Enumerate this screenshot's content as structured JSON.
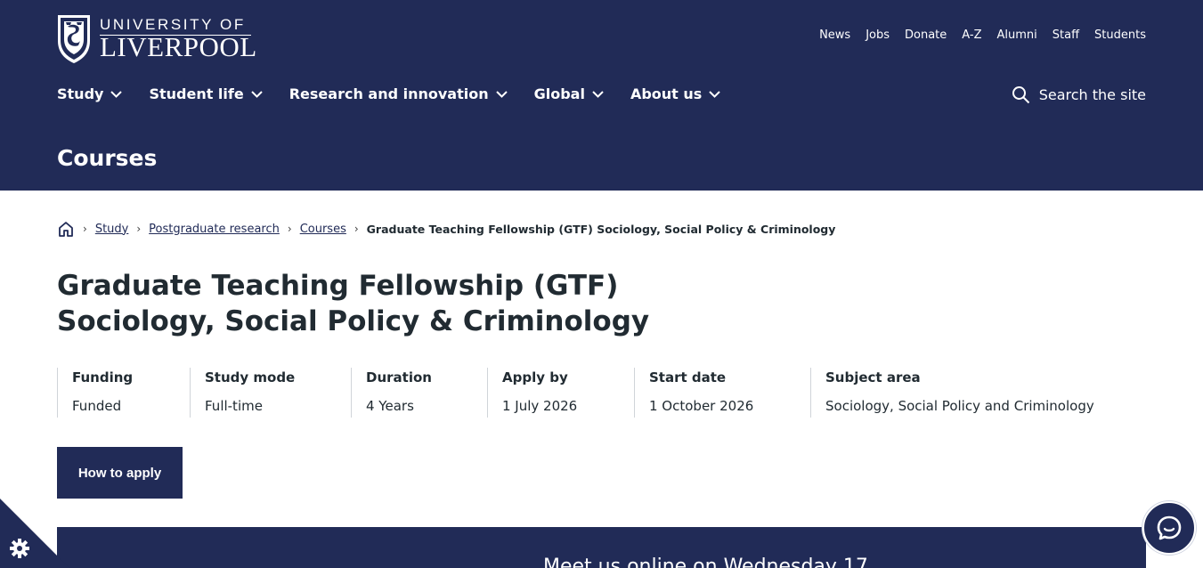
{
  "logo": {
    "line1": "UNIVERSITY OF",
    "line2": "LIVERPOOL"
  },
  "top_links": [
    "News",
    "Jobs",
    "Donate",
    "A-Z",
    "Alumni",
    "Staff",
    "Students"
  ],
  "main_nav": [
    "Study",
    "Student life",
    "Research and innovation",
    "Global",
    "About us"
  ],
  "search": {
    "label": "Search the site"
  },
  "section_title": "Courses",
  "breadcrumb": {
    "items": [
      "Study",
      "Postgraduate research",
      "Courses"
    ],
    "current": "Graduate Teaching Fellowship (GTF) Sociology, Social Policy & Criminology"
  },
  "page_title": {
    "line1": "Graduate Teaching Fellowship (GTF)",
    "line2": "Sociology, Social Policy & Criminology"
  },
  "facts": [
    {
      "label": "Funding",
      "value": "Funded"
    },
    {
      "label": "Study mode",
      "value": "Full-time"
    },
    {
      "label": "Duration",
      "value": "4 Years"
    },
    {
      "label": "Apply by",
      "value": "1 July 2026"
    },
    {
      "label": "Start date",
      "value": "1 October 2026"
    },
    {
      "label": "Subject area",
      "value": "Sociology, Social Policy and Criminology"
    }
  ],
  "apply_button": "How to apply",
  "banner_text": "Meet us online on Wednesday 17",
  "colors": {
    "brand_navy": "#212b57",
    "text": "#212b32"
  }
}
